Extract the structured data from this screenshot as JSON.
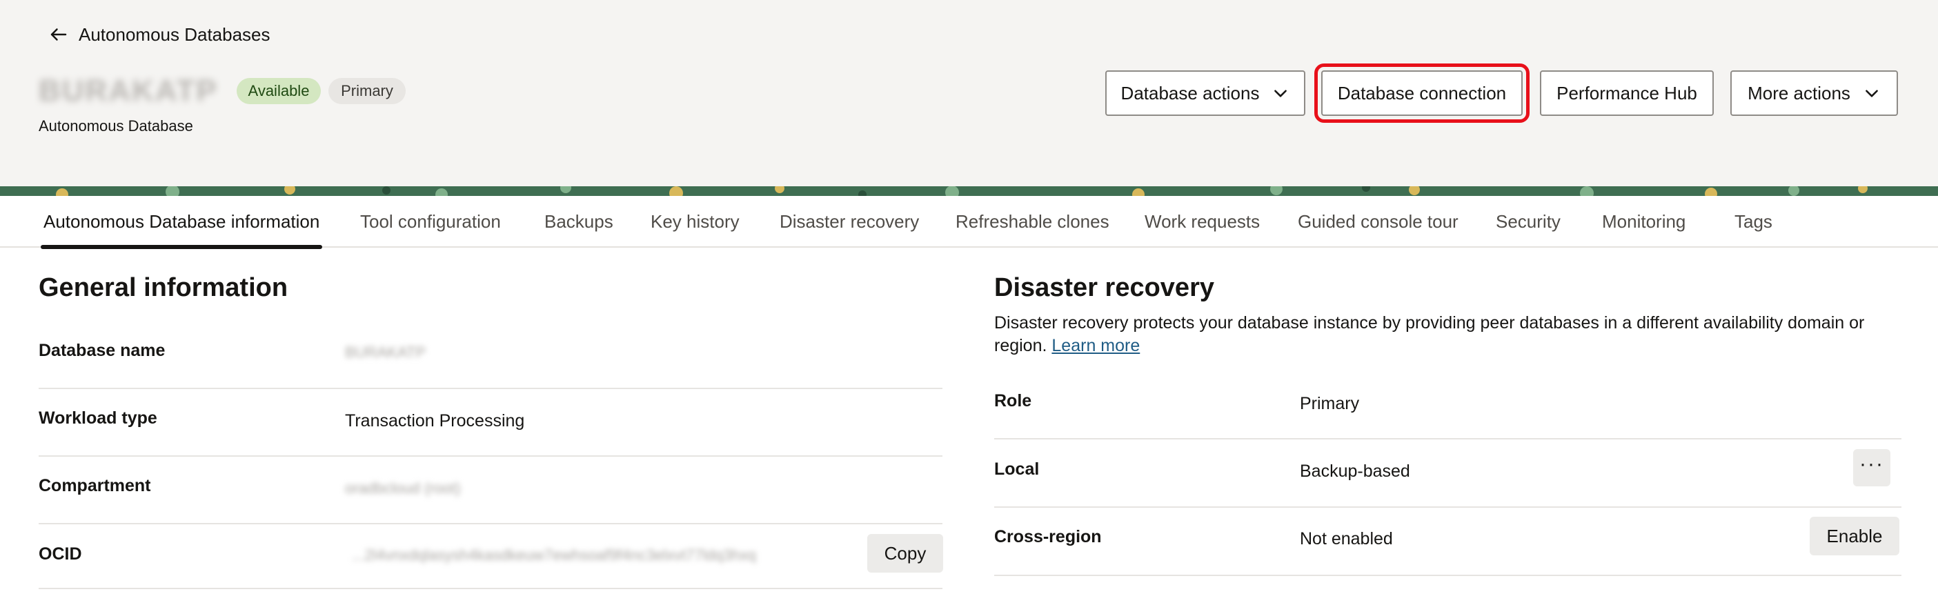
{
  "header": {
    "back_label": "Autonomous Databases",
    "db_name": "BURAKATP",
    "badges": {
      "status": "Available",
      "role": "Primary"
    },
    "db_type": "Autonomous Database",
    "actions": {
      "database_actions": "Database actions",
      "database_connection": "Database connection",
      "performance_hub": "Performance Hub",
      "more_actions": "More actions"
    }
  },
  "tabs": [
    "Autonomous Database information",
    "Tool configuration",
    "Backups",
    "Key history",
    "Disaster recovery",
    "Refreshable clones",
    "Work requests",
    "Guided console tour",
    "Security",
    "Monitoring",
    "Tags"
  ],
  "general": {
    "title": "General information",
    "rows": {
      "database_name": {
        "label": "Database name",
        "value": "BURAKATP"
      },
      "workload_type": {
        "label": "Workload type",
        "value": "Transaction Processing"
      },
      "compartment": {
        "label": "Compartment",
        "value": "oradbcloud (root)"
      },
      "ocid": {
        "label": "OCID",
        "value": "...2l4vnxdqlasysh4kasdkeuw7ewhsoaf9f4nc3elxvt77ldq3hxq",
        "copy_label": "Copy"
      }
    }
  },
  "disaster_recovery": {
    "title": "Disaster recovery",
    "description": "Disaster recovery protects your database instance by providing peer databases in a different availability domain or region.",
    "learn_more": "Learn more",
    "rows": {
      "role": {
        "label": "Role",
        "value": "Primary"
      },
      "local": {
        "label": "Local",
        "value": "Backup-based",
        "menu_label": "···"
      },
      "cross_region": {
        "label": "Cross-region",
        "value": "Not enabled",
        "action_label": "Enable"
      }
    }
  },
  "colors": {
    "header_bg": "#f5f4f2",
    "highlight": "#e8101a",
    "badge_available": "#d4e7c1",
    "link": "#1f5c85"
  }
}
